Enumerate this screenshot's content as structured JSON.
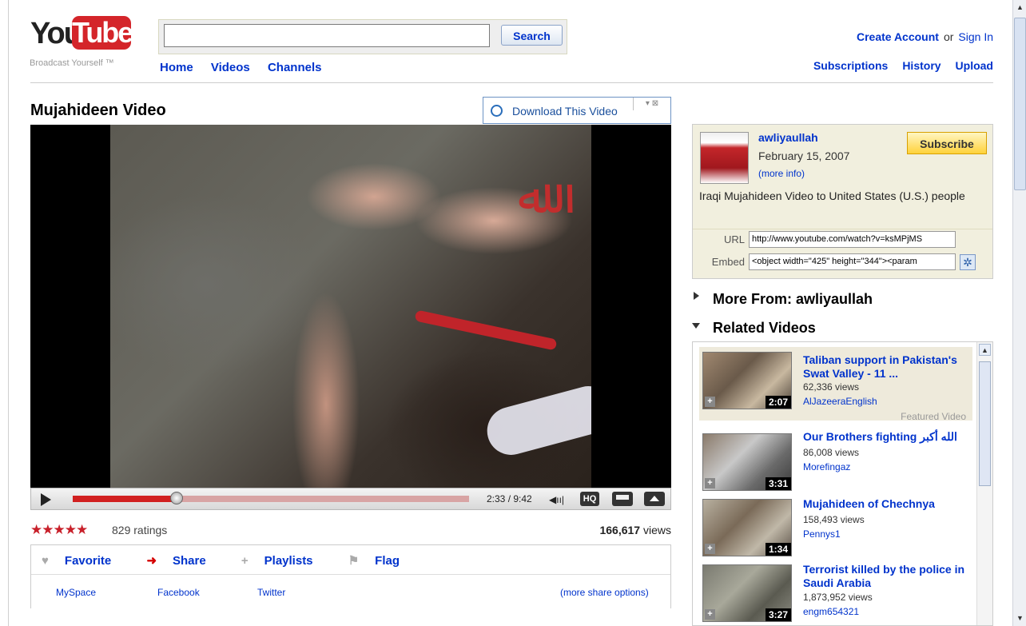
{
  "header": {
    "logo_you": "You",
    "logo_tube": "Tube",
    "tagline": "Broadcast Yourself ™",
    "search_button": "Search",
    "search_value": "",
    "nav": [
      "Home",
      "Videos",
      "Channels"
    ],
    "create_account": "Create Account",
    "or": "or",
    "sign_in": "Sign In",
    "subnav": [
      "Subscriptions",
      "History",
      "Upload"
    ]
  },
  "video": {
    "title": "Mujahideen Video",
    "download_label": "Download This Video",
    "time": "2:33 / 9:42",
    "progress_fraction": 0.263,
    "hq_label": "HQ",
    "ratings_count": "829 ratings",
    "stars": "★★★★★",
    "views_number": "166,617",
    "views_label": "views"
  },
  "actions": {
    "favorite": "Favorite",
    "share": "Share",
    "playlists": "Playlists",
    "flag": "Flag",
    "share_links": [
      "MySpace",
      "Facebook",
      "Twitter"
    ],
    "more_share": "(more share options)"
  },
  "channel": {
    "name": "awliyaullah",
    "date": "February 15, 2007",
    "more_info": "(more info)",
    "subscribe": "Subscribe",
    "description": "Iraqi Mujahideen Video to United States (U.S.) people",
    "url_label": "URL",
    "url_value": "http://www.youtube.com/watch?v=ksMPjMS",
    "embed_label": "Embed",
    "embed_value": "<object width=\"425\" height=\"344\"><param"
  },
  "more_from": "More From: awliyaullah",
  "related_heading": "Related Videos",
  "related": [
    {
      "title": "Taliban support in Pakistan's Swat Valley - 11 ...",
      "views": "62,336 views",
      "user": "AlJazeeraEnglish",
      "duration": "2:07",
      "featured": "Featured Video"
    },
    {
      "title": "Our Brothers fighting الله أكبر",
      "views": "86,008 views",
      "user": "Morefingaz",
      "duration": "3:31"
    },
    {
      "title": "Mujahideen of Chechnya",
      "views": "158,493 views",
      "user": "Pennys1",
      "duration": "1:34"
    },
    {
      "title": "Terrorist killed by the police in Saudi Arabia",
      "views": "1,873,952 views",
      "user": "engm654321",
      "duration": "3:27"
    }
  ]
}
